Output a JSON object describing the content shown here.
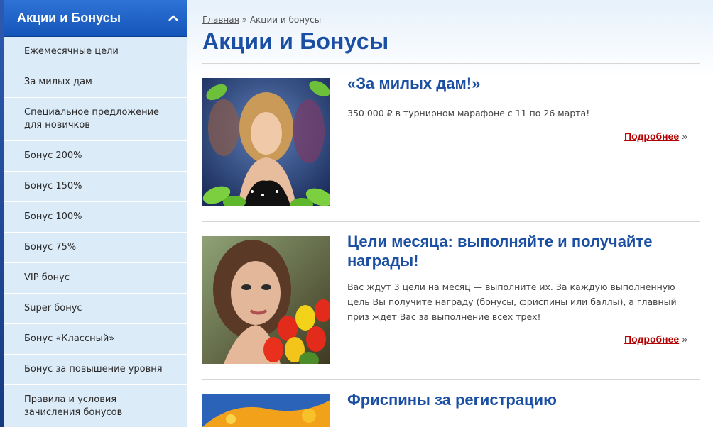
{
  "sidebar": {
    "header": "Акции и Бонусы",
    "items": [
      {
        "label": "Ежемесячные цели"
      },
      {
        "label": "За милых дам"
      },
      {
        "label": "Специальное предложение для новичков"
      },
      {
        "label": "Бонус 200%"
      },
      {
        "label": "Бонус 150%"
      },
      {
        "label": "Бонус 100%"
      },
      {
        "label": "Бонус 75%"
      },
      {
        "label": "VIP бонус"
      },
      {
        "label": "Super бонус"
      },
      {
        "label": "Бонус «Классный»"
      },
      {
        "label": "Бонус за повышение уровня"
      },
      {
        "label": "Правила и условия зачисления бонусов"
      }
    ]
  },
  "breadcrumb": {
    "home": "Главная",
    "separator": "»",
    "current": "Акции и бонусы"
  },
  "page_title": "Акции и Бонусы",
  "promos": [
    {
      "title": "«За милых дам!»",
      "desc": "350 000 ₽ в турнирном марафоне с 11 по 26 марта!",
      "more": "Подробнее",
      "more_arrow": "»"
    },
    {
      "title": "Цели месяца: выполняйте и получайте награды!",
      "desc": "Вас ждут 3 цели на месяц — выполните их. За каждую выполненную цель Вы получите награду (бонусы, фриспины или баллы), а главный приз ждет Вас за выполнение всех трех!",
      "more": "Подробнее",
      "more_arrow": "»"
    },
    {
      "title": "Фриспины за регистрацию"
    }
  ],
  "colors": {
    "accent": "#1b4fa3",
    "sidebar_bg": "#dcebf8",
    "link_red": "#b30000"
  }
}
